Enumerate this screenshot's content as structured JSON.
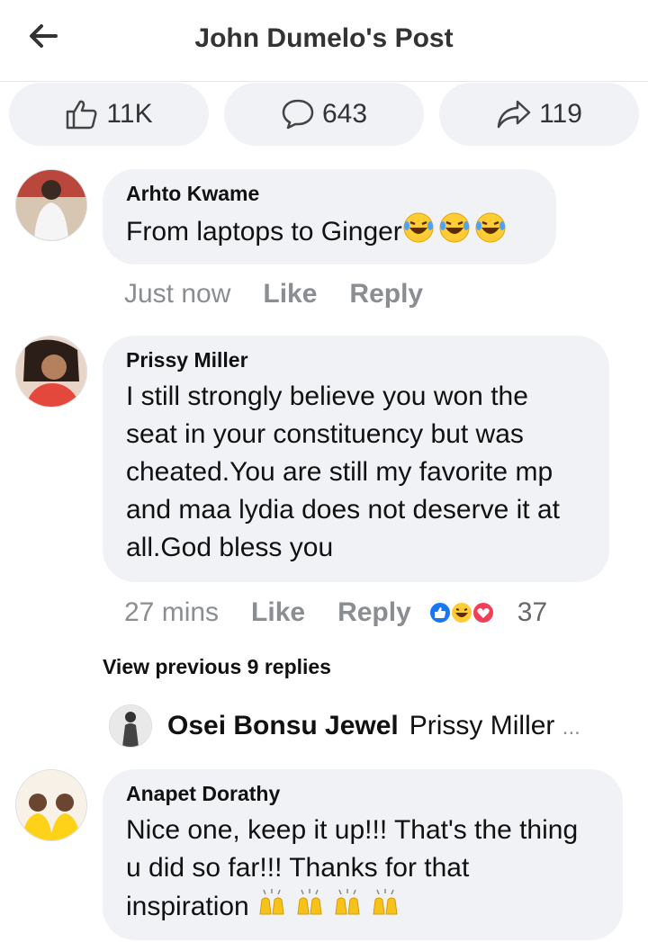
{
  "header": {
    "title": "John Dumelo's Post"
  },
  "stats": {
    "likes": "11K",
    "comments": "643",
    "shares": "119"
  },
  "comments": [
    {
      "author": "Arhto Kwame",
      "text": "From laptops to Ginger",
      "time": "Just now",
      "like": "Like",
      "reply": "Reply"
    },
    {
      "author": "Prissy Miller",
      "text_lines": [
        "I still strongly believe you won the",
        "seat in your constituency but was",
        "cheated.You are still my favorite mp",
        "and maa lydia does not deserve it at",
        "all.God bless you"
      ],
      "time": "27 mins",
      "like": "Like",
      "reply": "Reply",
      "reaction_count": "37"
    },
    {
      "author": "Anapet Dorathy",
      "text_lines": [
        "Nice one, keep it up!!! That's the thing",
        "u did so far!!! Thanks for that",
        "inspiration"
      ]
    }
  ],
  "replies": {
    "view_previous": "View previous 9 replies",
    "reply_author": "Osei Bonsu Jewel",
    "reply_preview": "Prissy Miller",
    "ellipsis": "..."
  },
  "icons": {
    "back": "arrow-left-icon",
    "like": "thumbs-up-icon",
    "comment": "speech-bubble-icon",
    "share": "share-arrow-icon",
    "laugh": "laughing-tears-emoji",
    "clap": "clapping-hands-emoji"
  },
  "colors": {
    "bubble": "#f0f2f5",
    "meta": "#8a8d91",
    "like_blue": "#1877f2",
    "love_red": "#f33e58"
  }
}
